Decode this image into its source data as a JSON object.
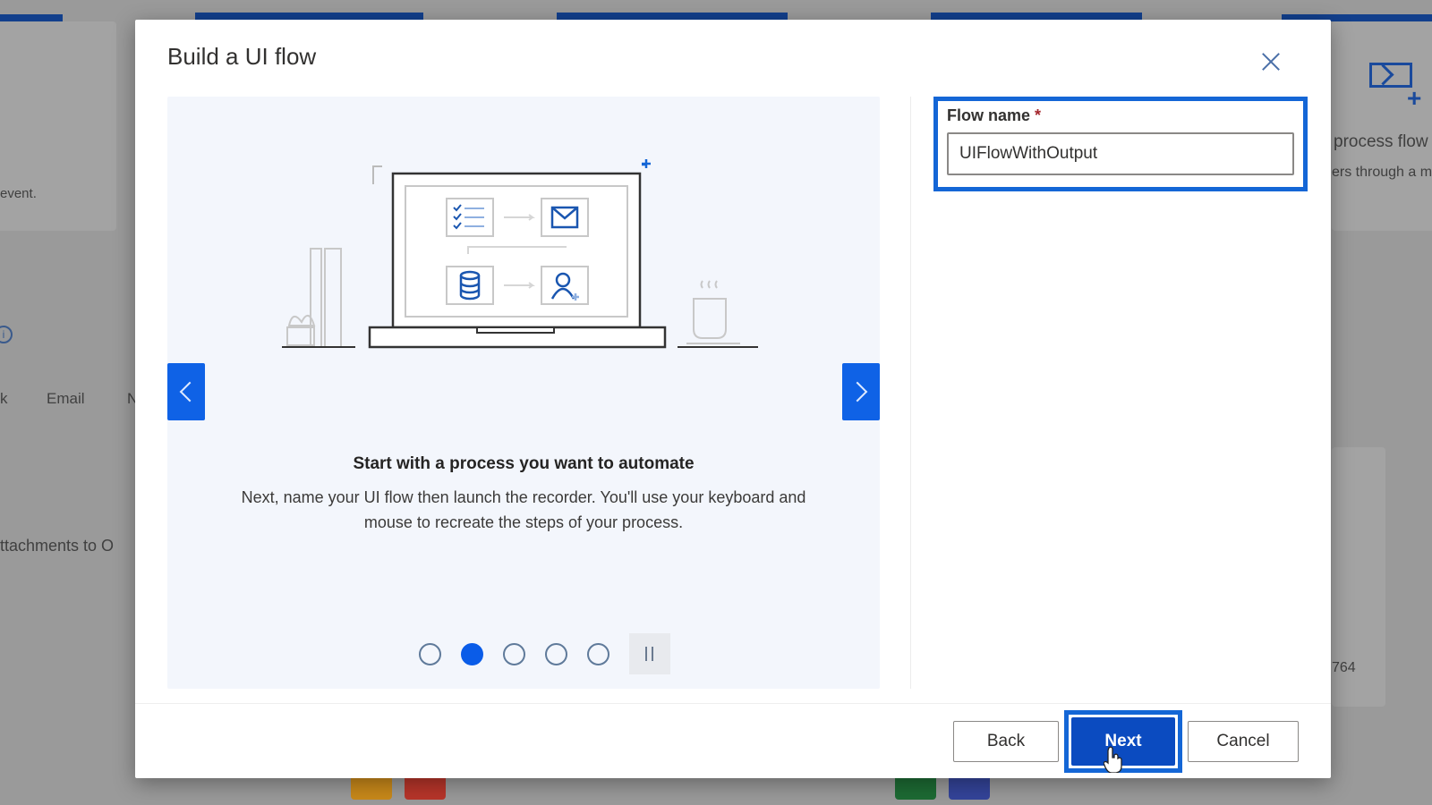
{
  "background": {
    "text_fragments": [
      "event.",
      "k",
      "Email",
      "N",
      "ttachments to O",
      "process flow",
      "ers through a m",
      "764"
    ],
    "info_icon": "info-icon",
    "flow_icon": "desktop-flow-icon"
  },
  "dialog": {
    "title": "Build a UI flow",
    "close_icon": "close-icon",
    "carousel": {
      "slide_title": "Start with a process you want to automate",
      "slide_description": "Next, name your UI flow then launch the recorder. You'll use your keyboard and mouse to recreate the steps of your process.",
      "prev_icon": "chevron-left-icon",
      "next_icon": "chevron-right-icon",
      "dot_count": 5,
      "active_dot": 2,
      "pause_icon": "pause-icon"
    },
    "form": {
      "flow_name_label": "Flow name",
      "required_marker": "*",
      "flow_name_value": "UIFlowWithOutput"
    },
    "footer": {
      "back_label": "Back",
      "next_label": "Next",
      "cancel_label": "Cancel"
    }
  },
  "colors": {
    "accent": "#0f62e6",
    "primary_button": "#0b4bc0",
    "focus_ring": "#1466d6",
    "required": "#a4262c"
  }
}
